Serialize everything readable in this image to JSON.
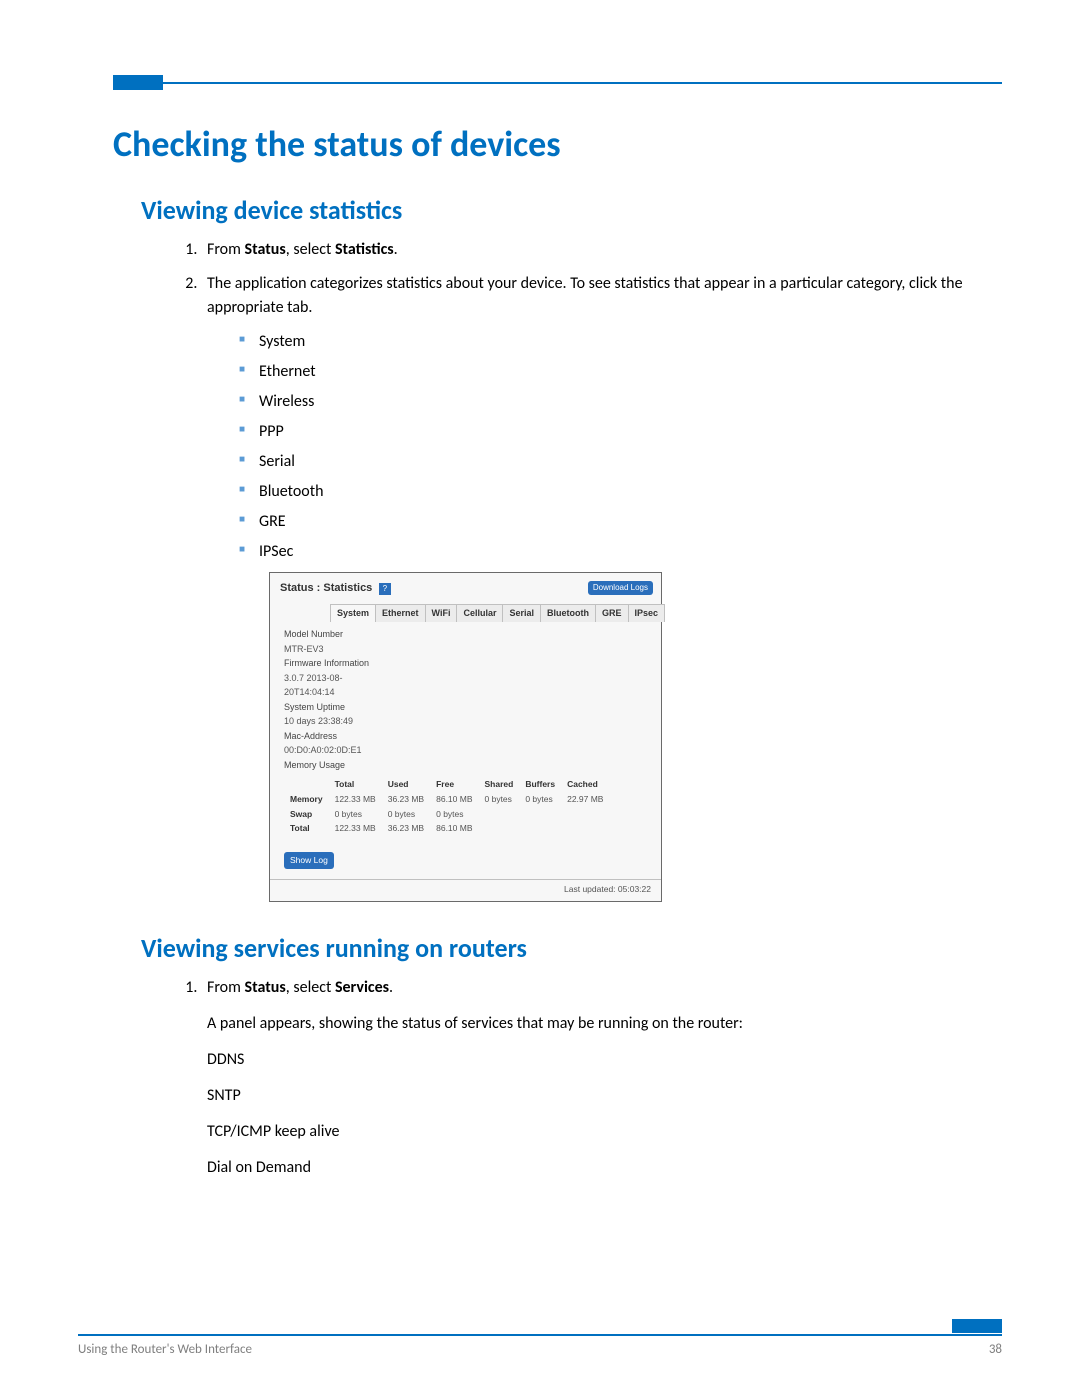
{
  "header_title": "Checking the status of devices",
  "section1": {
    "title": "Viewing device statistics",
    "step1_prefix": "From ",
    "step1_b1": "Status",
    "step1_mid": ", select ",
    "step1_b2": "Statistics",
    "step1_suffix": ".",
    "step2": "The application categorizes statistics about your device. To see statistics that appear in a particular category, click the appropriate tab.",
    "categories": [
      "System",
      "Ethernet",
      "Wireless",
      "PPP",
      "Serial",
      "Bluetooth",
      "GRE",
      "IPSec"
    ]
  },
  "panel": {
    "title": "Status : Statistics",
    "help": "?",
    "download": "Download Logs",
    "tabs": [
      "System",
      "Ethernet",
      "WiFi",
      "Cellular",
      "Serial",
      "Bluetooth",
      "GRE",
      "IPsec"
    ],
    "sys": {
      "model_label": "Model Number",
      "model_value": "MTR-EV3",
      "fw_label": "Firmware Information",
      "fw_value1": "3.0.7 2013-08-",
      "fw_value2": "20T14:04:14",
      "uptime_label": "System Uptime",
      "uptime_value": "10 days 23:38:49",
      "mac_label": "Mac-Address",
      "mac_value": "00:D0:A0:02:0D:E1",
      "mem_label": "Memory Usage"
    },
    "mem_headers": [
      "",
      "Total",
      "Used",
      "Free",
      "Shared",
      "Buffers",
      "Cached"
    ],
    "mem_rows": [
      {
        "label": "Memory",
        "total": "122.33 MB",
        "used": "36.23 MB",
        "free": "86.10 MB",
        "shared": "0 bytes",
        "buffers": "0 bytes",
        "cached": "22.97 MB"
      },
      {
        "label": "Swap",
        "total": "0 bytes",
        "used": "0 bytes",
        "free": "0 bytes",
        "shared": "",
        "buffers": "",
        "cached": ""
      },
      {
        "label": "Total",
        "total": "122.33 MB",
        "used": "36.23 MB",
        "free": "86.10 MB",
        "shared": "",
        "buffers": "",
        "cached": ""
      }
    ],
    "showlog": "Show Log",
    "updated": "Last updated: 05:03:22"
  },
  "section2": {
    "title": "Viewing services running on routers",
    "step1_prefix": "From ",
    "step1_b1": "Status",
    "step1_mid": ", select ",
    "step1_b2": "Services",
    "step1_suffix": ".",
    "desc": "A panel appears, showing the status of services that may be running on the router:",
    "services": [
      "DDNS",
      "SNTP",
      "TCP/ICMP keep alive",
      "Dial on Demand"
    ]
  },
  "footer_left": "Using the Router's Web Interface",
  "footer_right": "38"
}
